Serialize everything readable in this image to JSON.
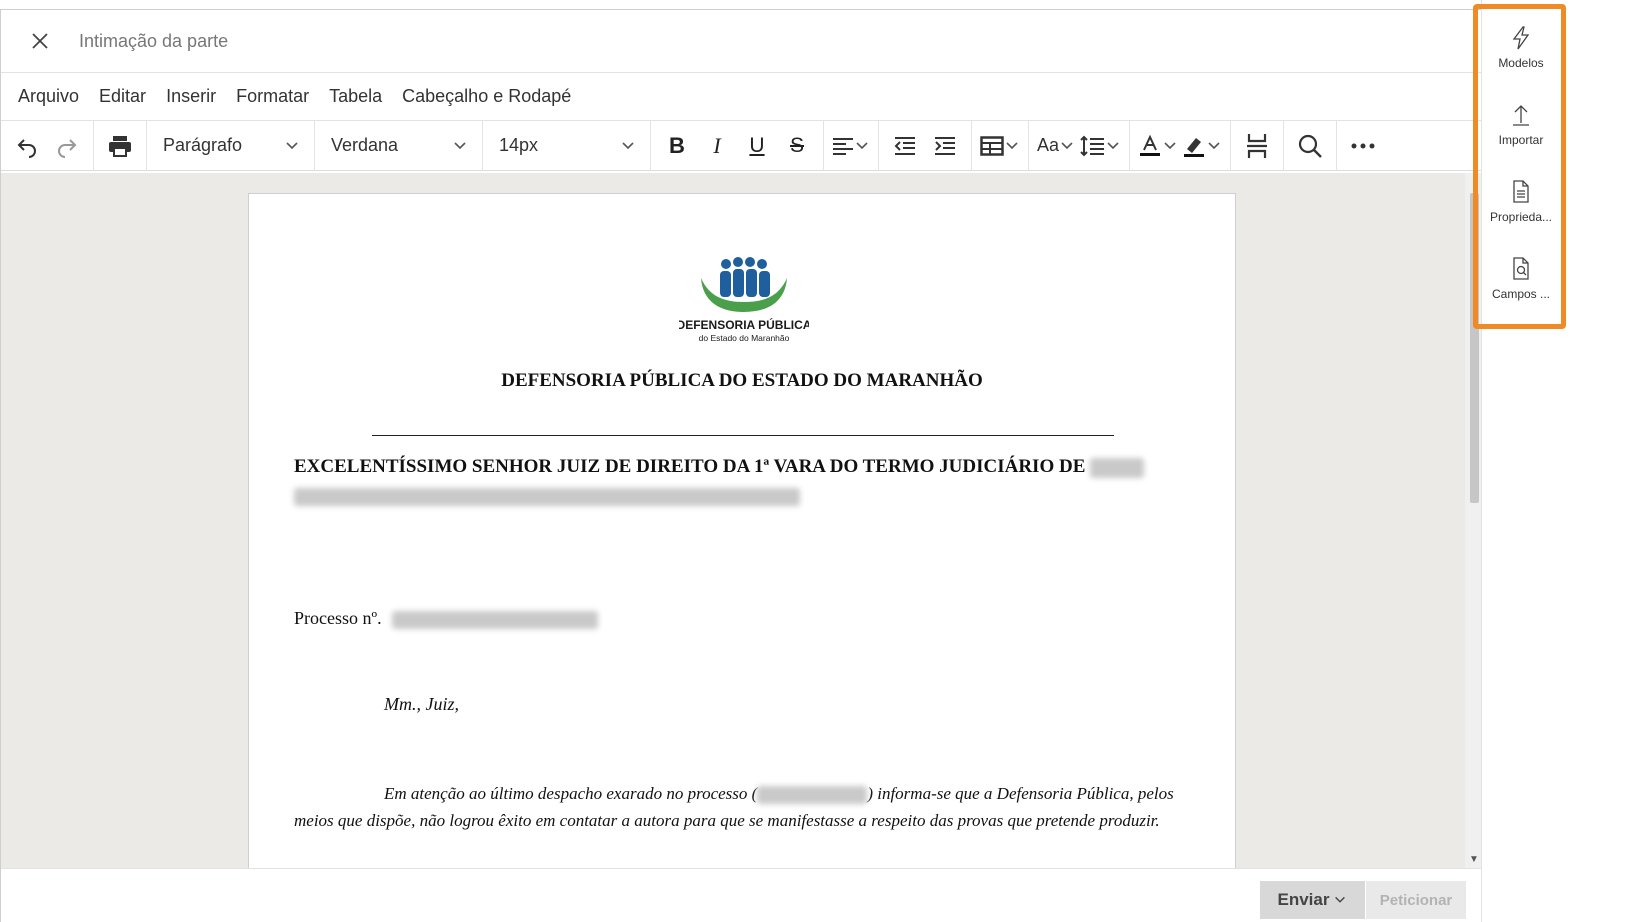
{
  "window": {
    "title": "Intimação da parte"
  },
  "menu": [
    "Arquivo",
    "Editar",
    "Inserir",
    "Formatar",
    "Tabela",
    "Cabeçalho e Rodapé"
  ],
  "toolbar": {
    "block_format": "Parágrafo",
    "font_family": "Verdana",
    "font_size": "14px",
    "case_label": "Aa"
  },
  "document": {
    "logo_text_1": "DEFENSORIA PÚBLICA",
    "logo_text_2": "do Estado do Maranhão",
    "heading": "DEFENSORIA PÚBLICA DO ESTADO DO MARANHÃO",
    "addressee": "EXCELENTÍSSIMO SENHOR JUIZ DE DIREITO DA 1ª VARA DO TERMO JUDICIÁRIO DE",
    "processo_label": "Processo nº.",
    "salutation": "Mm., Juiz,",
    "body_part1": "Em atenção ao último despacho exarado no processo (",
    "body_part2": ") informa-se que a Defensoria Pública, pelos meios que dispõe, não logrou êxito em contatar a autora para que se manifestasse a respeito das provas que pretende produzir."
  },
  "footer": {
    "send_label": "Enviar",
    "petition_label": "Peticionar"
  },
  "side_panel": [
    {
      "label": "Modelos",
      "icon": "lightning-icon"
    },
    {
      "label": "Importar",
      "icon": "upload-icon"
    },
    {
      "label": "Proprieda...",
      "icon": "document-properties-icon"
    },
    {
      "label": "Campos ...",
      "icon": "document-search-icon"
    }
  ],
  "colors": {
    "highlight": "#f08a24",
    "logo_green": "#4aa04a",
    "logo_blue": "#1f5f9e"
  }
}
